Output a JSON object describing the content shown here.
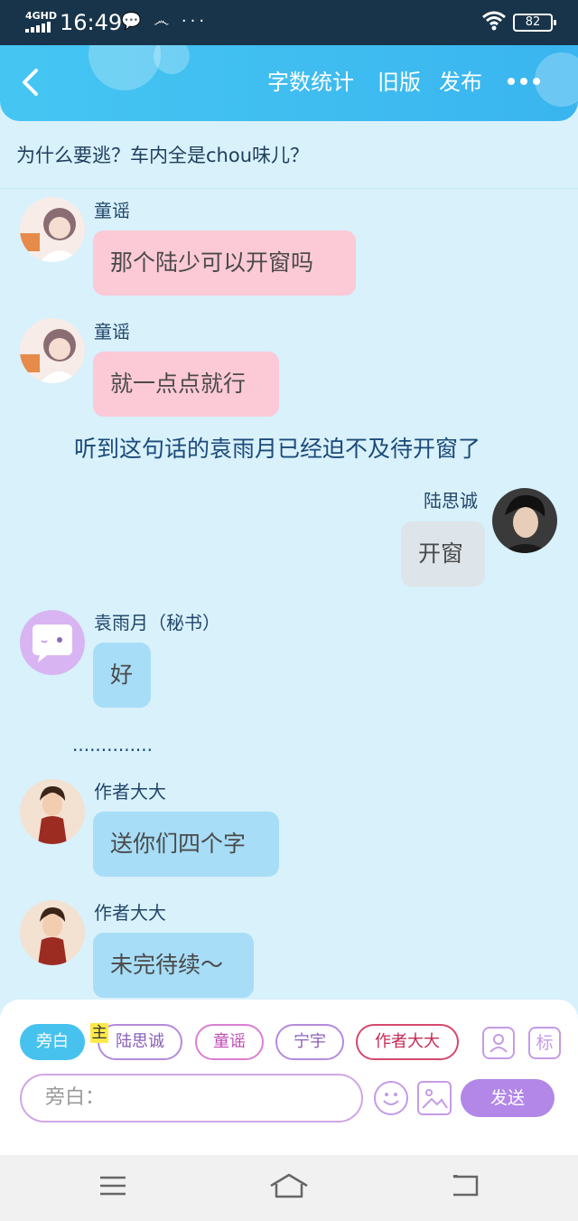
{
  "status_bar": {
    "network": "4GHD",
    "time": "16:49",
    "notification_icons": "💬 ෴ ···",
    "battery": "82"
  },
  "header": {
    "links": [
      "字数统计",
      "旧版",
      "发布"
    ]
  },
  "story": {
    "title": "为什么要逃？车内全是chou味儿？"
  },
  "messages": [
    {
      "type": "left",
      "sender": "童谣",
      "text": "那个陆少可以开窗吗",
      "style": "pink"
    },
    {
      "type": "left",
      "sender": "童谣",
      "text": "就一点点就行",
      "style": "pink"
    },
    {
      "type": "narration",
      "text": "听到这句话的袁雨月已经迫不及待开窗了"
    },
    {
      "type": "right",
      "sender": "陆思诚",
      "text": "开窗",
      "style": "gray"
    },
    {
      "type": "left",
      "sender": "袁雨月（秘书）",
      "text": "好",
      "style": "blue"
    },
    {
      "type": "narration",
      "text": ".............."
    },
    {
      "type": "left",
      "sender": "作者大大",
      "text": "送你们四个字",
      "style": "blue"
    },
    {
      "type": "left",
      "sender": "作者大大",
      "text": "未完待续～",
      "style": "blue"
    }
  ],
  "composer": {
    "characters": [
      "旁白",
      "陆思诚",
      "童谣",
      "宁宇",
      "作者大大"
    ],
    "main_badge": "主",
    "tag_button": "标",
    "input_placeholder": "旁白：",
    "send_label": "发送"
  },
  "colors": {
    "header": "#45c6f2",
    "background": "#d8f1fb",
    "pink_bubble": "#fcc9d6",
    "blue_bubble": "#a7ddf6",
    "send_button": "#b287e7"
  }
}
